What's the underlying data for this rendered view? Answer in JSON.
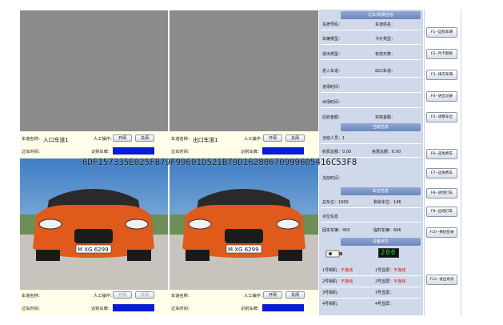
{
  "lanes": [
    {
      "name_label": "车道名称：",
      "name": "入口车道1",
      "manual_label": "人工操作：",
      "open_label": "开闸",
      "close_label": "关闸",
      "time_label": "过车时间：",
      "plate_label": "识别车牌："
    },
    {
      "name_label": "车道名称：",
      "name": "出口车道1",
      "manual_label": "人工操作：",
      "open_label": "开闸",
      "close_label": "关闸",
      "time_label": "过车时间：",
      "plate_label": "识别车牌："
    },
    {
      "name_label": "车道名称：",
      "name": "",
      "manual_label": "人工操作：",
      "open_label": "开闸",
      "close_label": "关闸",
      "time_label": "过车时间：",
      "plate_label": "识别车牌："
    },
    {
      "name_label": "车道名称：",
      "name": "",
      "manual_label": "人工操作：",
      "open_label": "开闸",
      "close_label": "关闸",
      "time_label": "过车时间：",
      "plate_label": "识别车牌："
    }
  ],
  "car_plate_text": "M XG 6299",
  "overlay_code": "6DF157335E025FB79F99601D521B79D16280670999605416C53F8",
  "info": {
    "section_title": "过车/收费信息",
    "plate_no": "车牌号码：",
    "lane_name": "车道姓名：",
    "plate_type": "车辆类型：",
    "card_type": "卡片类型：",
    "io_type": "进出类型：",
    "valid_days": "有效天数：",
    "in_lane": "进入车道：",
    "out_lane": "出口车道：",
    "in_time": "进场时间：",
    "out_time": "出场时间：",
    "due_amount": "应收金额：",
    "paid_amount": "实收金额："
  },
  "duty": {
    "section_title": "当班信息",
    "operator": "当班人员：1",
    "charge_total": "收费总额：0.00",
    "free_total": "免费总额：0.00",
    "duty_time": "当前时间："
  },
  "space": {
    "section_title": "车位信息",
    "total": "总车位：1000",
    "remain": "剩余车位：146",
    "spot_info": "点位信息",
    "fixed": "固定车辆：450",
    "temp": "临时车辆：696"
  },
  "device": {
    "section_title": "设备状态",
    "led_text": "200",
    "items": [
      {
        "label": "1号相机：",
        "status": "不连线"
      },
      {
        "label": "1号显屏：",
        "status": "不连线"
      },
      {
        "label": "2号相机：",
        "status": "不连线"
      },
      {
        "label": "2号显屏：",
        "status": "不连线"
      },
      {
        "label": "3号相机：",
        "status": ""
      },
      {
        "label": "3号显屏：",
        "status": ""
      },
      {
        "label": "4号相机：",
        "status": ""
      },
      {
        "label": "4号显屏：",
        "status": ""
      }
    ]
  },
  "function_keys": [
    "F1--远程车辆",
    "F2--月卡期限",
    "F3--场内车辆",
    "F4--进出记录",
    "F5--调整车位",
    "F6--选免费车",
    "F7--选免费车",
    "F8--进场打车",
    "F9--出场打车",
    "F10--换班登录",
    "F12--退出系统"
  ],
  "colors": {
    "plate_blue": "#0a1bd8",
    "panel_bg": "#cfd9ea",
    "section_header": "#7b93c6",
    "led_green": "#21d141",
    "status_red": "#e00000"
  }
}
